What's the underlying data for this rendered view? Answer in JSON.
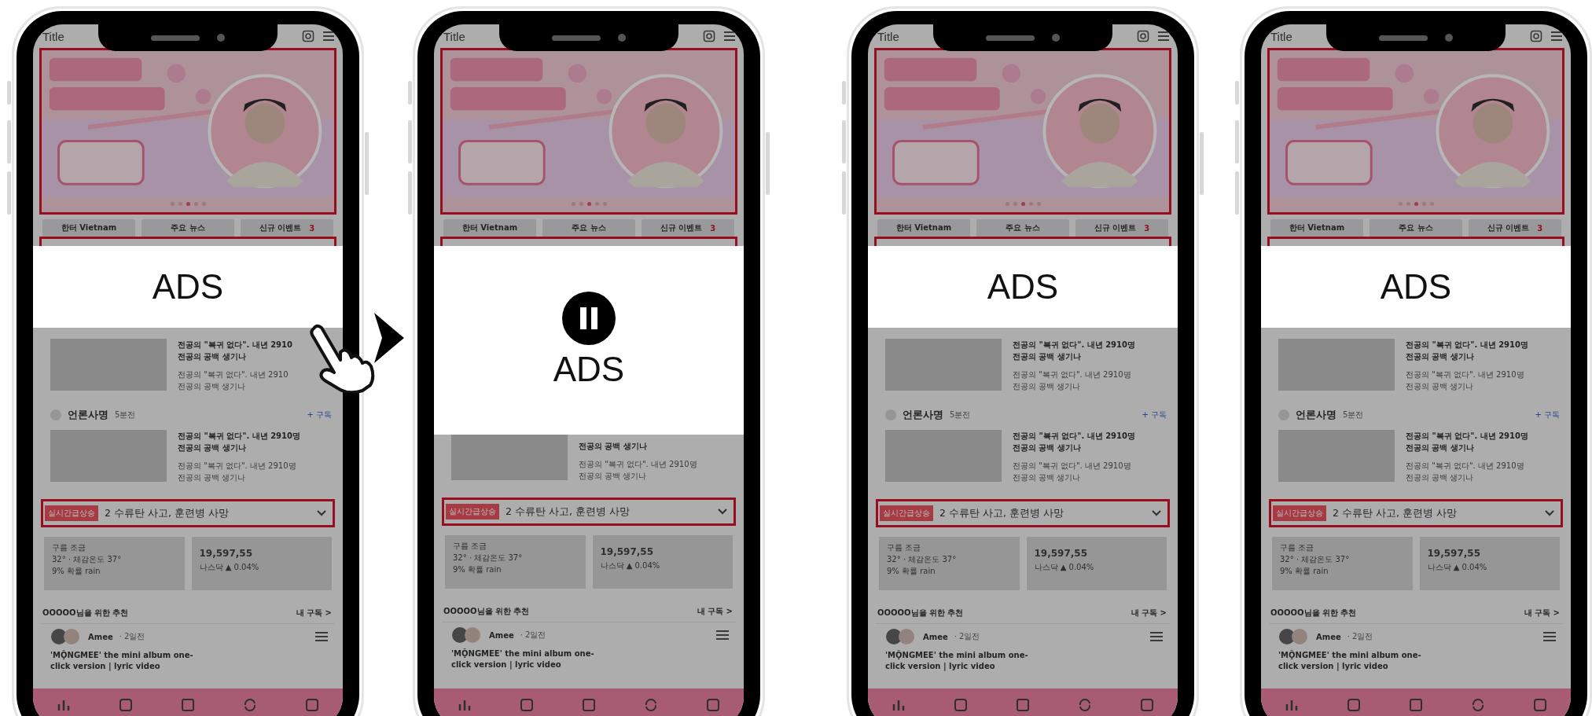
{
  "phones": [
    {
      "hand_cursor": true,
      "ad": {
        "label": "ADS",
        "paused": false
      },
      "screen": {
        "title": "Title",
        "banner": {
          "kind": "picture",
          "dots": [
            {
              "selected": false
            },
            {
              "selected": false
            },
            {
              "selected": true
            },
            {
              "selected": false
            },
            {
              "selected": false
            }
          ]
        },
        "tabs": [
          {
            "label": "한터 Vietnam"
          },
          {
            "label": "주요 뉴스"
          },
          {
            "label": "신규 이벤트",
            "badge": "3"
          }
        ],
        "article": {
          "title_lines": [
            "전공의 \"복귀 없다\". 내년 2910",
            "전공의 공백 생기나"
          ],
          "summary_lines": [
            "전공의 \"복귀 없다\". 내년 2910",
            "전공의 공백 생기나"
          ]
        },
        "press": {
          "name": "언론사명",
          "time": "5분전",
          "subscribe": "+ 구독"
        },
        "press_article": {
          "title_lines": [
            "전공의 \"복귀 없다\". 내년 2910명",
            "전공의 공백 생기나"
          ],
          "summary_lines": [
            "전공의 \"복귀 없다\". 내년 2910명",
            "전공의 공백 생기나"
          ]
        },
        "breaking": {
          "badge": "실시간급상승",
          "headline": "2 수류탄 사고, 훈련병 사망"
        },
        "weather": [
          "구름 조금",
          "32° · 체감온도 37°",
          "9% 확률 rain"
        ],
        "stock": {
          "value": "19,597,55",
          "change": "나스닥 ▲ 0.04%"
        },
        "recommend": {
          "title": "OOOOO님을 위한 추천",
          "link": "내 구독 >"
        },
        "post": {
          "author": "Amee",
          "time": "· 2일전",
          "title": "'MỘNGMEE' the mini album one-click version | lyric video"
        }
      }
    },
    {
      "hand_cursor": false,
      "ad": {
        "label": "ADS",
        "paused": true
      },
      "screen": {
        "title": "Title",
        "banner": {
          "kind": "picture",
          "dots": [
            {
              "selected": false
            },
            {
              "selected": false
            },
            {
              "selected": true
            },
            {
              "selected": false
            },
            {
              "selected": false
            }
          ]
        },
        "tabs": [
          {
            "label": "한터 Vietnam"
          },
          {
            "label": "주요 뉴스"
          },
          {
            "label": "신규 이벤트",
            "badge": "3"
          }
        ],
        "press_article": {
          "title_lines": [
            "전공의 공백 생기나"
          ],
          "summary_lines": [
            "전공의 \"복귀 없다\". 내년 2910명",
            "전공의 공백 생기나"
          ]
        },
        "breaking": {
          "badge": "실시간급상승",
          "headline": "2 수류탄 사고, 훈련병 사망"
        },
        "weather": [
          "구름 조금",
          "32° · 체감온도 37°",
          "9% 확률 rain"
        ],
        "stock": {
          "value": "19,597,55",
          "change": "나스닥 ▲ 0.04%"
        },
        "recommend": {
          "title": "OOOOO님을 위한 추천",
          "link": "내 구독 >"
        },
        "post": {
          "author": "Amee",
          "time": "· 2일전",
          "title": "'MỘNGMEE' the mini album one-click version | lyric video"
        }
      }
    },
    {
      "hand_cursor": false,
      "ad": {
        "label": "ADS",
        "paused": false
      },
      "screen": {
        "title": "Title",
        "banner": {
          "kind": "picture",
          "dots": [
            {
              "selected": false
            },
            {
              "selected": false
            },
            {
              "selected": true
            },
            {
              "selected": false
            },
            {
              "selected": false
            }
          ]
        },
        "tabs": [
          {
            "label": "한터 Vietnam"
          },
          {
            "label": "주요 뉴스"
          },
          {
            "label": "신규 이벤트",
            "badge": "3"
          }
        ],
        "article": {
          "title_lines": [
            "전공의 \"복귀 없다\". 내년 2910명",
            "전공의 공백 생기나"
          ],
          "summary_lines": [
            "전공의 \"복귀 없다\". 내년 2910명",
            "전공의 공백 생기나"
          ]
        },
        "press": {
          "name": "언론사명",
          "time": "5분전",
          "subscribe": "+ 구독"
        },
        "press_article": {
          "title_lines": [
            "전공의 \"복귀 없다\". 내년 2910명",
            "전공의 공백 생기나"
          ],
          "summary_lines": [
            "전공의 \"복귀 없다\". 내년 2910명",
            "전공의 공백 생기나"
          ]
        },
        "breaking": {
          "badge": "실시간급상승",
          "headline": "2 수류탄 사고, 훈련병 사망"
        },
        "weather": [
          "구름 조금",
          "32° · 체감온도 37°",
          "9% 확률 rain"
        ],
        "stock": {
          "value": "19,597,55",
          "change": "나스닥 ▲ 0.04%"
        },
        "recommend": {
          "title": "OOOOO님을 위한 추천",
          "link": "내 구독 >"
        },
        "post": {
          "author": "Amee",
          "time": "· 2일전",
          "title": "'MỘNGMEE' the mini album one-click version | lyric video"
        }
      }
    },
    {
      "hand_cursor": false,
      "ad": {
        "label": "ADS",
        "paused": false
      },
      "screen": {
        "title": "Title",
        "banner": {
          "kind": "picture",
          "dots": [
            {
              "selected": false
            },
            {
              "selected": false
            },
            {
              "selected": true
            },
            {
              "selected": false
            },
            {
              "selected": false
            }
          ]
        },
        "tabs": [
          {
            "label": "한터 Vietnam"
          },
          {
            "label": "주요 뉴스"
          },
          {
            "label": "신규 이벤트",
            "badge": "3"
          }
        ],
        "article": {
          "title_lines": [
            "전공의 \"복귀 없다\". 내년 2910명",
            "전공의 공백 생기나"
          ],
          "summary_lines": [
            "전공의 \"복귀 없다\". 내년 2910명",
            "전공의 공백 생기나"
          ]
        },
        "press": {
          "name": "언론사명",
          "time": "5분전",
          "subscribe": "+ 구독"
        },
        "press_article": {
          "title_lines": [
            "전공의 \"복귀 없다\". 내년 2910명",
            "전공의 공백 생기나"
          ],
          "summary_lines": [
            "전공의 \"복귀 없다\". 내년 2910명",
            "전공의 공백 생기나"
          ]
        },
        "breaking": {
          "badge": "실시간급상승",
          "headline": "2 수류탄 사고, 훈련병 사망"
        },
        "weather": [
          "구름 조금",
          "32° · 체감온도 37°",
          "9% 확률 rain"
        ],
        "stock": {
          "value": "19,597,55",
          "change": "나스닥 ▲ 0.04%"
        },
        "recommend": {
          "title": "OOOOO님을 위한 추천",
          "link": "내 구독 >"
        },
        "post": {
          "author": "Amee",
          "time": "· 2일전",
          "title": "'MỘNGMEE' the mini album one-click version | lyric video"
        }
      }
    }
  ]
}
